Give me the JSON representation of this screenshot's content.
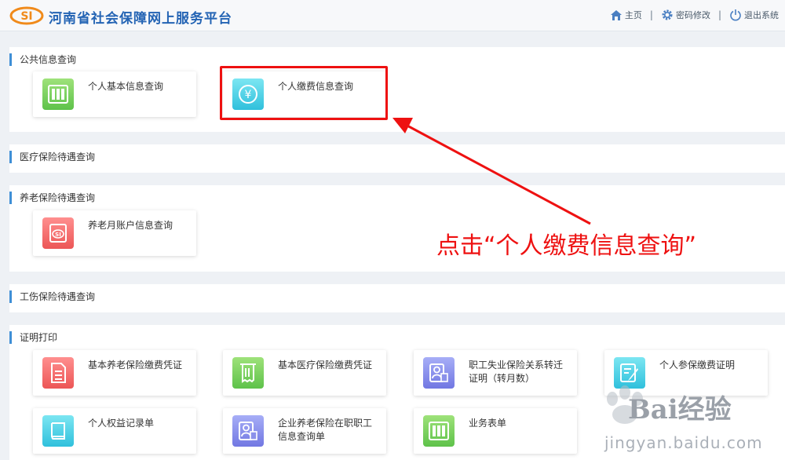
{
  "header": {
    "logo_text": "SI",
    "title": "河南省社会保障网上服务平台",
    "nav": {
      "home": "主页",
      "password": "密码修改",
      "logout": "退出系统"
    },
    "separator": "|"
  },
  "sections": {
    "public": {
      "title": "公共信息查询",
      "cards": [
        {
          "label": "个人基本信息查询",
          "icon": "columns-icon",
          "color": "green"
        },
        {
          "label": "个人缴费信息查询",
          "icon": "yen-coin-icon",
          "color": "cyan"
        }
      ]
    },
    "medical": {
      "title": "医疗保险待遇查询"
    },
    "pension": {
      "title": "养老保险待遇查询",
      "cards": [
        {
          "label": "养老月账户信息查询",
          "icon": "si-document-icon",
          "color": "red"
        }
      ]
    },
    "injury": {
      "title": "工伤保险待遇查询"
    },
    "certificate": {
      "title": "证明打印",
      "cards": [
        {
          "label": "基本养老保险缴费凭证",
          "icon": "document-icon",
          "color": "red"
        },
        {
          "label": "基本医疗保险缴费凭证",
          "icon": "receipt-icon",
          "color": "green"
        },
        {
          "label": "职工失业保险关系转迁证明（转月数）",
          "icon": "person-document-icon",
          "color": "purple"
        },
        {
          "label": "个人参保缴费证明",
          "icon": "edit-document-icon",
          "color": "cyan"
        },
        {
          "label": "个人权益记录单",
          "icon": "book-icon",
          "color": "cyan"
        },
        {
          "label": "企业养老保险在职职工信息查询单",
          "icon": "person-document-icon",
          "color": "purple"
        },
        {
          "label": "业务表单",
          "icon": "columns-icon",
          "color": "green"
        }
      ]
    }
  },
  "annotation": {
    "text": "点击“个人缴费信息查询”",
    "color": "#ee1111"
  },
  "watermark": {
    "text": "Bai经验",
    "url": "jingyan.baidu.com"
  },
  "colors": {
    "accent": "#3f8fd6",
    "title": "#2464b4"
  }
}
